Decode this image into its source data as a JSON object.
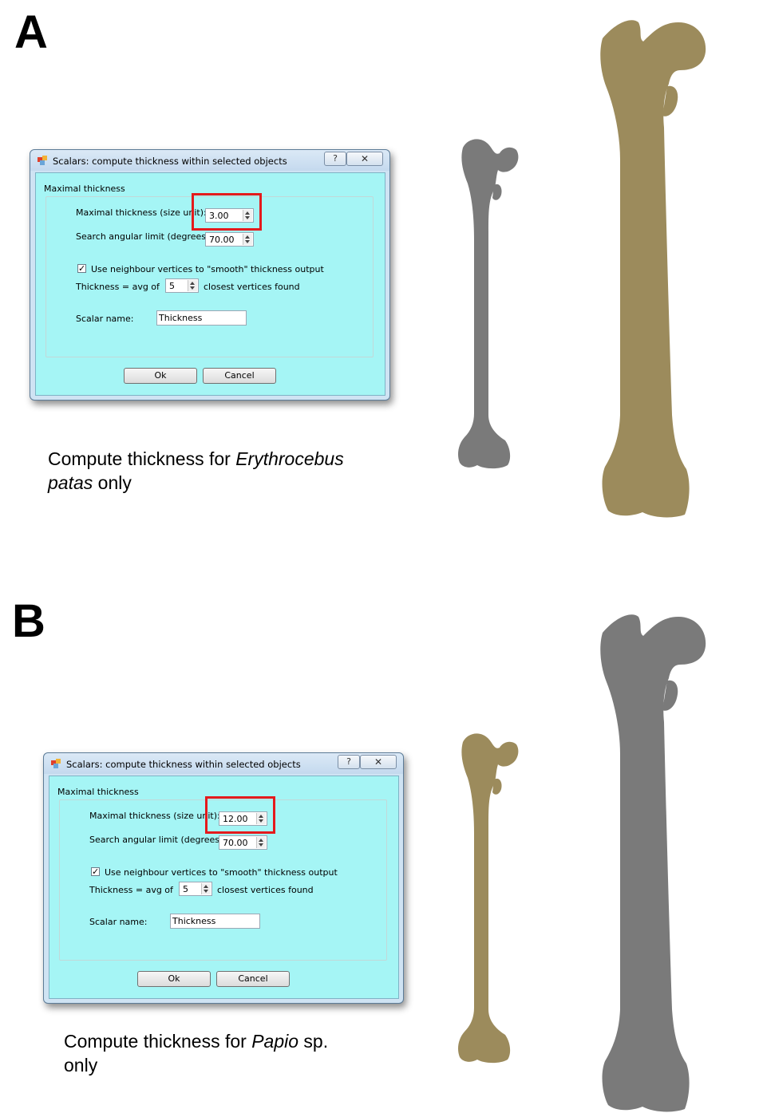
{
  "panels": [
    {
      "letter": "A",
      "dialog": {
        "title": "Scalars: compute thickness within selected objects",
        "help_glyph": "?",
        "close_glyph": "✕",
        "group_title": "Maximal thickness",
        "max_thickness_label": "Maximal thickness (size unit):",
        "max_thickness_value": "3.00",
        "angular_label": "Search angular limit (degrees):",
        "angular_value": "70.00",
        "smooth_checkbox_label": "Use neighbour vertices to \"smooth\" thickness output",
        "smooth_checked": true,
        "check_glyph": "✓",
        "avg_label": "Thickness = avg of",
        "avg_value": "5",
        "avg_suffix": "closest vertices found",
        "scalar_name_label": "Scalar name:",
        "scalar_name_value": "Thickness",
        "ok_label": "Ok",
        "cancel_label": "Cancel"
      },
      "caption": {
        "prefix": "Compute thickness for ",
        "species_line1": "Erythrocebus",
        "species_line2": "patas",
        "suffix": " only"
      },
      "small_bone_color": "#7a7a7a",
      "large_bone_color": "#9c8b5c"
    },
    {
      "letter": "B",
      "dialog": {
        "title": "Scalars: compute thickness within selected objects",
        "help_glyph": "?",
        "close_glyph": "✕",
        "group_title": "Maximal thickness",
        "max_thickness_label": "Maximal thickness (size unit):",
        "max_thickness_value": "12.00",
        "angular_label": "Search angular limit (degrees):",
        "angular_value": "70.00",
        "smooth_checkbox_label": "Use neighbour vertices to \"smooth\" thickness output",
        "smooth_checked": true,
        "check_glyph": "✓",
        "avg_label": "Thickness = avg of",
        "avg_value": "5",
        "avg_suffix": "closest vertices found",
        "scalar_name_label": "Scalar name:",
        "scalar_name_value": "Thickness",
        "ok_label": "Ok",
        "cancel_label": "Cancel"
      },
      "caption": {
        "prefix": "Compute thickness for ",
        "species": "Papio",
        "suffix1": " sp.",
        "suffix2": "only"
      },
      "small_bone_color": "#9c8b5c",
      "large_bone_color": "#7a7a7a"
    }
  ],
  "highlight_color": "#e41a1c"
}
